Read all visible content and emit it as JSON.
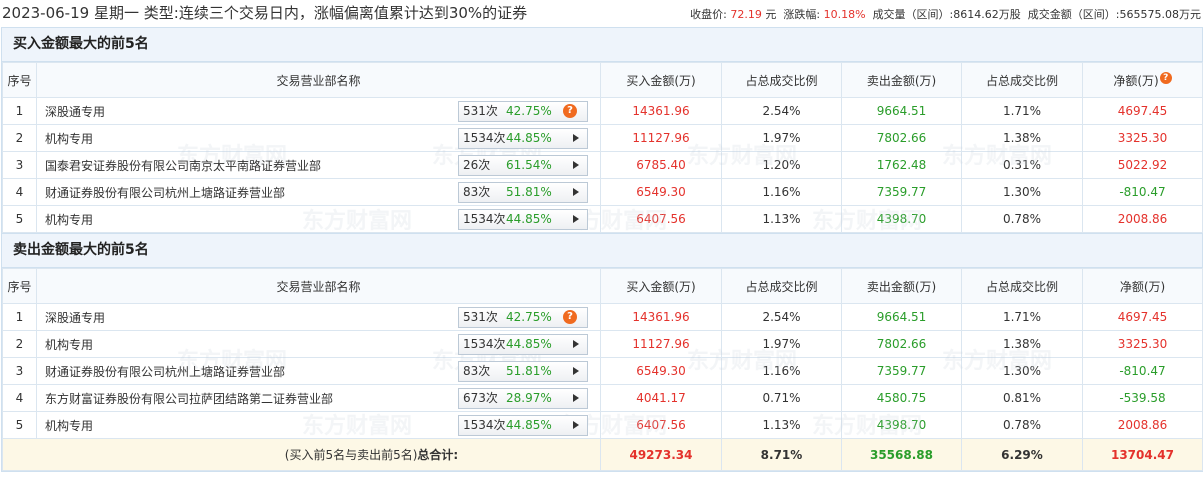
{
  "header": {
    "date": "2023-06-19",
    "weekday": "星期一",
    "type_label": "类型:",
    "type_text": "连续三个交易日内，涨幅偏离值累计达到30%的证券",
    "close_label": "收盘价:",
    "close_value": "72.19",
    "close_unit": "元",
    "change_label": "涨跌幅:",
    "change_value": "10.18%",
    "volume_label": "成交量（区间）:",
    "volume_value": "8614.62万股",
    "amount_label": "成交金额（区间）:",
    "amount_value": "565575.08万元"
  },
  "columns": [
    "序号",
    "交易营业部名称",
    "买入金额(万)",
    "占总成交比例",
    "卖出金额(万)",
    "占总成交比例",
    "净额(万)"
  ],
  "buy_section": {
    "title": "买入金额最大的前5名",
    "rows": [
      {
        "no": "1",
        "name": "深股通专用",
        "count": "531次",
        "pct": "42.75%",
        "btn": "q",
        "buy": "14361.96",
        "buy_ratio": "2.54%",
        "sell": "9664.51",
        "sell_ratio": "1.71%",
        "net": "4697.45",
        "net_color": "red"
      },
      {
        "no": "2",
        "name": "机构专用",
        "count": "1534次",
        "pct": "44.85%",
        "btn": "arrow",
        "buy": "11127.96",
        "buy_ratio": "1.97%",
        "sell": "7802.66",
        "sell_ratio": "1.38%",
        "net": "3325.30",
        "net_color": "red"
      },
      {
        "no": "3",
        "name": "国泰君安证券股份有限公司南京太平南路证券营业部",
        "count": "26次",
        "pct": "61.54%",
        "btn": "arrow",
        "buy": "6785.40",
        "buy_ratio": "1.20%",
        "sell": "1762.48",
        "sell_ratio": "0.31%",
        "net": "5022.92",
        "net_color": "red"
      },
      {
        "no": "4",
        "name": "财通证券股份有限公司杭州上塘路证券营业部",
        "count": "83次",
        "pct": "51.81%",
        "btn": "arrow",
        "buy": "6549.30",
        "buy_ratio": "1.16%",
        "sell": "7359.77",
        "sell_ratio": "1.30%",
        "net": "-810.47",
        "net_color": "green"
      },
      {
        "no": "5",
        "name": "机构专用",
        "count": "1534次",
        "pct": "44.85%",
        "btn": "arrow",
        "buy": "6407.56",
        "buy_ratio": "1.13%",
        "sell": "4398.70",
        "sell_ratio": "0.78%",
        "net": "2008.86",
        "net_color": "red"
      }
    ]
  },
  "sell_section": {
    "title": "卖出金额最大的前5名",
    "rows": [
      {
        "no": "1",
        "name": "深股通专用",
        "count": "531次",
        "pct": "42.75%",
        "btn": "q",
        "buy": "14361.96",
        "buy_ratio": "2.54%",
        "sell": "9664.51",
        "sell_ratio": "1.71%",
        "net": "4697.45",
        "net_color": "red"
      },
      {
        "no": "2",
        "name": "机构专用",
        "count": "1534次",
        "pct": "44.85%",
        "btn": "arrow",
        "buy": "11127.96",
        "buy_ratio": "1.97%",
        "sell": "7802.66",
        "sell_ratio": "1.38%",
        "net": "3325.30",
        "net_color": "red"
      },
      {
        "no": "3",
        "name": "财通证券股份有限公司杭州上塘路证券营业部",
        "count": "83次",
        "pct": "51.81%",
        "btn": "arrow",
        "buy": "6549.30",
        "buy_ratio": "1.16%",
        "sell": "7359.77",
        "sell_ratio": "1.30%",
        "net": "-810.47",
        "net_color": "green"
      },
      {
        "no": "4",
        "name": "东方财富证券股份有限公司拉萨团结路第二证券营业部",
        "count": "673次",
        "pct": "28.97%",
        "btn": "arrow",
        "buy": "4041.17",
        "buy_ratio": "0.71%",
        "sell": "4580.75",
        "sell_ratio": "0.81%",
        "net": "-539.58",
        "net_color": "green"
      },
      {
        "no": "5",
        "name": "机构专用",
        "count": "1534次",
        "pct": "44.85%",
        "btn": "arrow",
        "buy": "6407.56",
        "buy_ratio": "1.13%",
        "sell": "4398.70",
        "sell_ratio": "0.78%",
        "net": "2008.86",
        "net_color": "red"
      }
    ]
  },
  "total": {
    "label_prefix": "(买入前5名与卖出前5名)",
    "label_bold": "总合计:",
    "buy": "49273.34",
    "buy_ratio": "8.71%",
    "sell": "35568.88",
    "sell_ratio": "6.29%",
    "net": "13704.47"
  },
  "watermark": {
    "cn": "东方财富网",
    "en": "eastmoney.com"
  },
  "colors": {
    "red": "#e4322c",
    "green": "#2a9d2a",
    "header_bg": "#eef4fb",
    "total_bg": "#fdf8e6",
    "help_icon": "#f06a1f"
  }
}
